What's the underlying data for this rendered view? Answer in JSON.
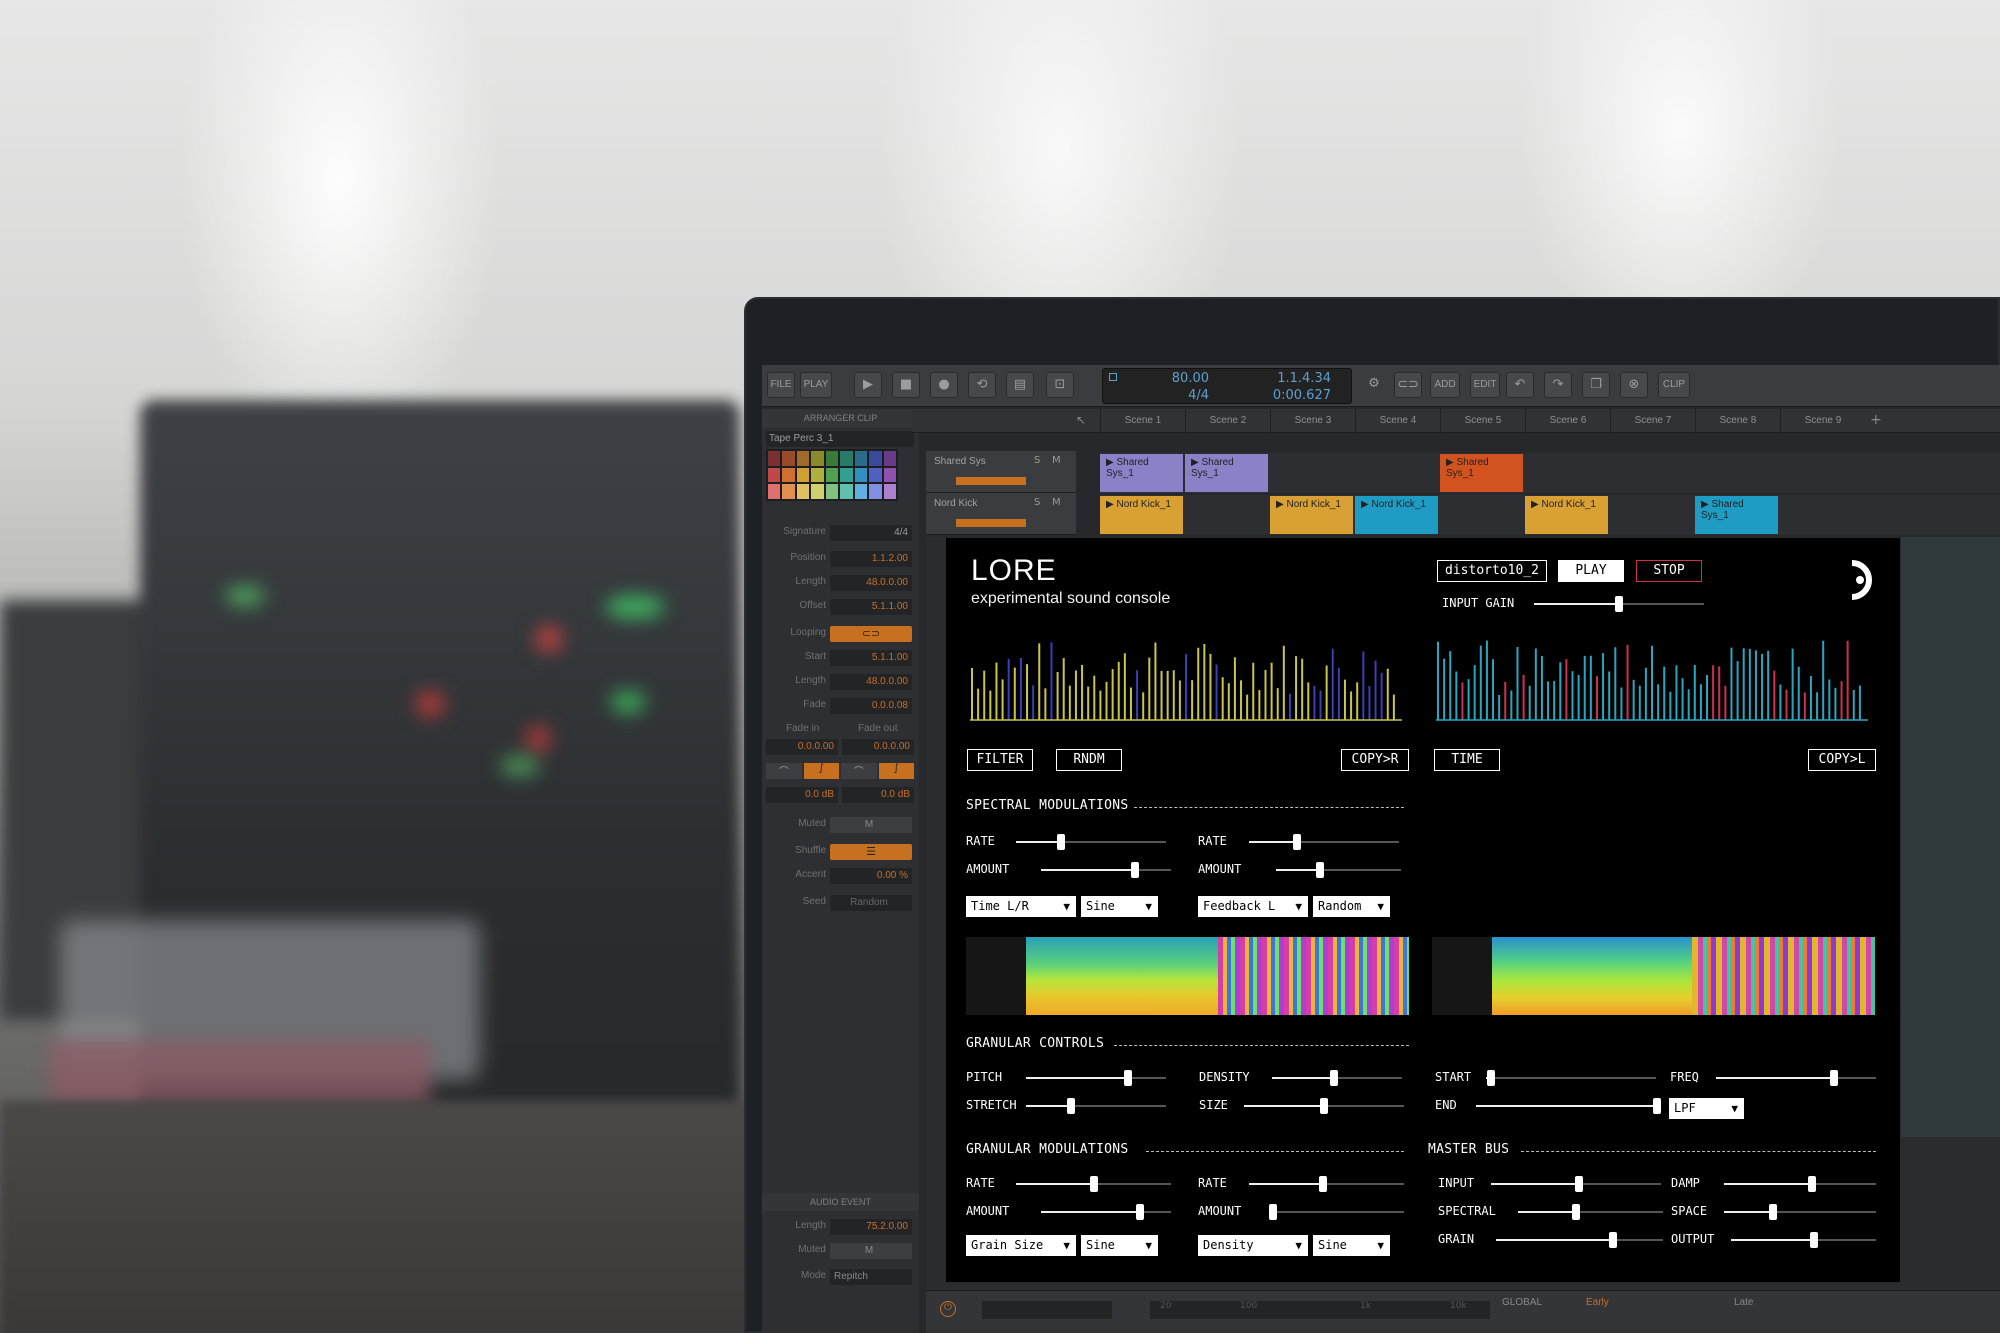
{
  "daw": {
    "toolbar": {
      "file": "FILE",
      "play": "PLAY",
      "add": "ADD",
      "edit": "EDIT",
      "clip": "CLIP",
      "tempo": "80.00",
      "signature": "4/4",
      "position": "1.1.4.34",
      "time": "0:00.627"
    },
    "inspector": {
      "section_title": "ARRANGER CLIP",
      "clip_name": "Tape Perc 3_1",
      "rows": [
        {
          "label": "Signature",
          "value": "4/4"
        },
        {
          "label": "Position",
          "value": "1.1.2.00"
        },
        {
          "label": "Length",
          "value": "48.0.0.00"
        },
        {
          "label": "Offset",
          "value": "5.1.1.00"
        },
        {
          "label": "Looping",
          "value": ""
        },
        {
          "label": "Start",
          "value": "5.1.1.00"
        },
        {
          "label": "Length",
          "value": "48.0.0.00"
        },
        {
          "label": "Fade",
          "value": "0.0.0.08"
        }
      ],
      "fade_in_label": "Fade in",
      "fade_out_label": "Fade out",
      "fade_in_value": "0.0.0.00",
      "fade_out_value": "0.0.0.00",
      "fade_in_db": "0.0 dB",
      "fade_out_db": "0.0 dB",
      "muted_label": "Muted",
      "muted_value": "M",
      "shuffle_label": "Shuffle",
      "accent_label": "Accent",
      "accent_value": "0.00 %",
      "seed_label": "Seed",
      "seed_value": "Random",
      "audio_event_title": "AUDIO EVENT",
      "ae_length_label": "Length",
      "ae_length_value": "75.2.0.00",
      "ae_muted_label": "Muted",
      "ae_muted_value": "M",
      "ae_mode_label": "Mode",
      "ae_mode_value": "Repitch"
    },
    "scenes": [
      "Scene 1",
      "Scene 2",
      "Scene 3",
      "Scene 4",
      "Scene 5",
      "Scene 6",
      "Scene 7",
      "Scene 8",
      "Scene 9"
    ],
    "tracks": [
      {
        "name": "Shared Sys",
        "solo": "S",
        "mute": "M"
      },
      {
        "name": "Nord Kick",
        "solo": "S",
        "mute": "M"
      }
    ],
    "clips_row1": [
      {
        "scene": 0,
        "label": "Shared Sys_1",
        "color": "#8a82c8"
      },
      {
        "scene": 1,
        "label": "Shared Sys_1",
        "color": "#8a82c8"
      },
      {
        "scene": 4,
        "label": "Shared Sys_1",
        "color": "#d2531f"
      }
    ],
    "clips_row2": [
      {
        "scene": 0,
        "label": "Nord Kick_1",
        "color": "#d9a033"
      },
      {
        "scene": 2,
        "label": "Nord Kick_1",
        "color": "#d9a033"
      },
      {
        "scene": 3,
        "label": "Nord Kick_1",
        "color": "#1f9cc4"
      },
      {
        "scene": 5,
        "label": "Nord Kick_1",
        "color": "#d9a033"
      },
      {
        "scene": 7,
        "label": "Shared Sys_1",
        "color": "#1f9cc4"
      }
    ],
    "bottom": {
      "global": "GLOBAL",
      "early": "Early",
      "late": "Late",
      "ticks": [
        "20",
        "100",
        "1k",
        "10k"
      ]
    }
  },
  "plugin": {
    "title": "LORE",
    "subtitle": "experimental sound console",
    "preset": "distorto10_2",
    "play": "PLAY",
    "stop": "STOP",
    "input_gain_label": "INPUT GAIN",
    "input_gain": 0.5,
    "left_buttons": {
      "filter": "FILTER",
      "rndm": "RNDM",
      "copy": "COPY>R"
    },
    "right_buttons": {
      "time": "TIME",
      "copy": "COPY>L"
    },
    "spectral_modulations": {
      "title": "SPECTRAL MODULATIONS",
      "left": {
        "rate_label": "RATE",
        "rate": 0.3,
        "amount_label": "AMOUNT",
        "amount": 0.72,
        "target": "Time L/R",
        "shape": "Sine"
      },
      "right": {
        "rate_label": "RATE",
        "rate": 0.32,
        "amount_label": "AMOUNT",
        "amount": 0.35,
        "target": "Feedback L",
        "shape": "Random"
      }
    },
    "granular_controls": {
      "title": "GRANULAR CONTROLS",
      "pitch_label": "PITCH",
      "pitch": 0.73,
      "stretch_label": "STRETCH",
      "stretch": 0.32,
      "density_label": "DENSITY",
      "density": 0.48,
      "size_label": "SIZE",
      "size": 0.5,
      "start_label": "START",
      "start": 0.03,
      "end_label": "END",
      "end": 0.98,
      "freq_label": "FREQ",
      "freq": 0.74,
      "filter_type": "LPF"
    },
    "granular_modulations": {
      "title": "GRANULAR MODULATIONS",
      "left": {
        "rate_label": "RATE",
        "rate": 0.5,
        "amount_label": "AMOUNT",
        "amount": 0.76,
        "target": "Grain Size",
        "shape": "Sine"
      },
      "right": {
        "rate_label": "RATE",
        "rate": 0.48,
        "amount_label": "AMOUNT",
        "amount": 0.03,
        "target": "Density",
        "shape": "Sine"
      }
    },
    "master_bus": {
      "title": "MASTER BUS",
      "input_label": "INPUT",
      "input": 0.52,
      "spectral_label": "SPECTRAL",
      "spectral": 0.4,
      "grain_label": "GRAIN",
      "grain": 0.7,
      "damp_label": "DAMP",
      "damp": 0.58,
      "space_label": "SPACE",
      "space": 0.32,
      "output_label": "OUTPUT",
      "output": 0.57
    },
    "colors": {
      "left_bars": [
        "#c9c44a",
        "#3b3fb5"
      ],
      "right_bars": [
        "#2aa7c0",
        "#d0304f"
      ],
      "stop_border": "#d0304f"
    }
  }
}
